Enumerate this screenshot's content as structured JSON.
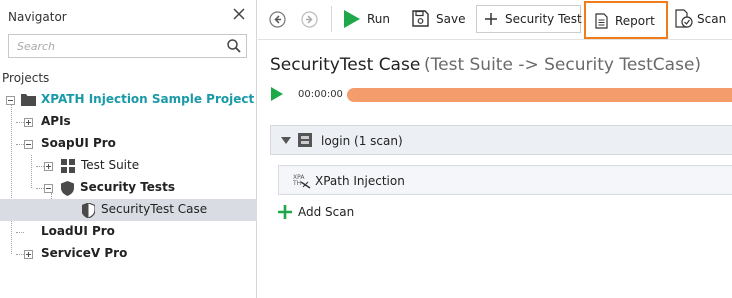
{
  "navigator": {
    "title": "Navigator",
    "search_placeholder": "Search",
    "projects_label": "Projects",
    "tree": {
      "project": "XPATH Injection Sample Project",
      "apis": "APIs",
      "soapui": "SoapUI Pro",
      "test_suite": "Test Suite",
      "security_tests": "Security Tests",
      "security_test_case": "SecurityTest Case",
      "loadui": "LoadUI Pro",
      "servicev": "ServiceV Pro"
    }
  },
  "toolbar": {
    "run_label": "Run",
    "save_label": "Save",
    "security_test_label": "Security Test",
    "report_label": "Report",
    "scan_label": "Scan"
  },
  "main": {
    "title": "SecurityTest Case",
    "subtitle": "(Test Suite -> Security TestCase)",
    "elapsed": "00:00:00",
    "progress": 1.0,
    "login_label": "login (1 scan)",
    "scan_label": "XPath Injection",
    "add_scan_label": "Add Scan"
  },
  "colors": {
    "accent_orange": "#f07c1c",
    "progress": "#f49c6b",
    "run_green": "#1ea84a",
    "project_teal": "#1a9aa8"
  }
}
